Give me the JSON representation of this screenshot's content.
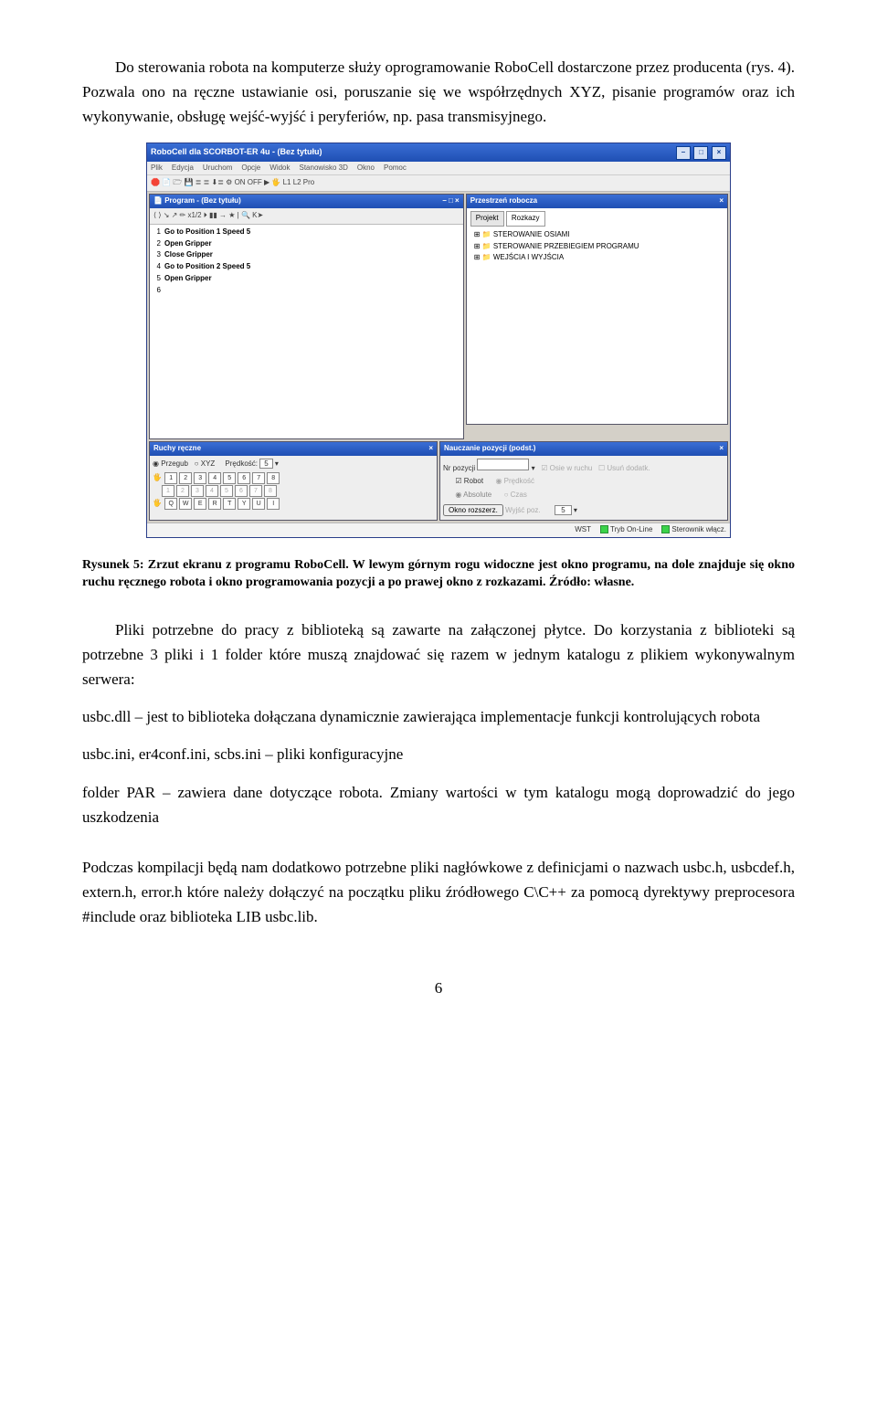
{
  "paragraphs": {
    "p1": "Do sterowania robota na komputerze służy oprogramowanie RoboCell dostarczone przez producenta (rys. 4). Pozwala ono na ręczne ustawianie osi, poruszanie się we współrzędnych XYZ, pisanie programów oraz ich wykonywanie, obsługę wejść-wyjść i peryferiów, np. pasa transmisyjnego.",
    "p2a": "Pliki potrzebne do pracy z biblioteką są zawarte na załączonej płytce. Do korzystania z biblioteki są potrzebne 3 pliki i 1 folder które muszą znajdować się razem w jednym katalogu z plikiem wykonywalnym serwera:",
    "p2b": "usbc.dll – jest to biblioteka dołączana dynamicznie zawierająca implementacje funkcji kontrolujących robota",
    "p2c": "usbc.ini, er4conf.ini, scbs.ini – pliki konfiguracyjne",
    "p2d": "folder PAR – zawiera dane dotyczące robota. Zmiany wartości w tym katalogu mogą doprowadzić do jego uszkodzenia",
    "p3": "Podczas kompilacji będą nam dodatkowo potrzebne pliki nagłówkowe z definicjami o nazwach usbc.h, usbcdef.h, extern.h, error.h które należy dołączyć na początku pliku źródłowego C\\C++ za pomocą dyrektywy preprocesora #include oraz biblioteka LIB usbc.lib."
  },
  "caption": "Rysunek 5: Zrzut ekranu z programu RoboCell. W lewym górnym rogu widoczne jest okno programu, na dole znajduje się okno ruchu ręcznego robota i okno programowania pozycji a po prawej okno z rozkazami. Źródło: własne.",
  "app": {
    "title": "RoboCell dla SCORBOT-ER 4u - (Bez tytułu)",
    "menu": [
      "Plik",
      "Edycja",
      "Uruchom",
      "Opcje",
      "Widok",
      "Stanowisko 3D",
      "Okno",
      "Pomoc"
    ],
    "toolbar": "🛑  📄 🗁 💾   ≣ ≣ ⬇≣  ⚙  ON OFF ▶ 🖐  L1 L2 Pro",
    "left": {
      "program": {
        "title": "Program -  (Bez tytułu)",
        "toolbar": "⟨ ⟩  ↘ ↗  ✏  x1/2  ⏵  ▮▮  →  ★ | 🔍  K➤",
        "lines": [
          "Go to Position 1 Speed 5",
          "Open Gripper",
          "Close Gripper",
          "Go to Position 2 Speed 5",
          "Open Gripper",
          ""
        ]
      },
      "manual": {
        "title": "Ruchy ręczne",
        "mode1": "Przegub",
        "mode2": "XYZ",
        "speed_label": "Prędkość:",
        "speed": "5",
        "keys_row1": [
          "1",
          "2",
          "3",
          "4",
          "5",
          "6",
          "7",
          "8"
        ],
        "keys_row2": [
          "1",
          "2",
          "3",
          "4",
          "5",
          "6",
          "7",
          "8"
        ],
        "keys_row3": [
          "Q",
          "W",
          "E",
          "R",
          "T",
          "Y",
          "U",
          "I"
        ]
      }
    },
    "right": {
      "workspace": {
        "title": "Przestrzeń robocza",
        "tabs": [
          "Projekt",
          "Rozkazy"
        ],
        "tree": [
          "STEROWANIE OSIAMI",
          "STEROWANIE PRZEBIEGIEM PROGRAMU",
          "WEJŚCIA I WYJŚCIA"
        ]
      },
      "teach": {
        "title": "Nauczanie pozycji (podst.)",
        "fields": {
          "nr": "Nr pozycji",
          "robot": "Robot",
          "absolute": "Absolute",
          "speed": "5"
        },
        "btns": [
          "Okno rozszerz.",
          "Wyjść poz."
        ]
      }
    },
    "status": {
      "wst": "WST",
      "mode": "Tryb On-Line",
      "ctrl": "Sterownik włącz."
    }
  },
  "page_number": "6"
}
